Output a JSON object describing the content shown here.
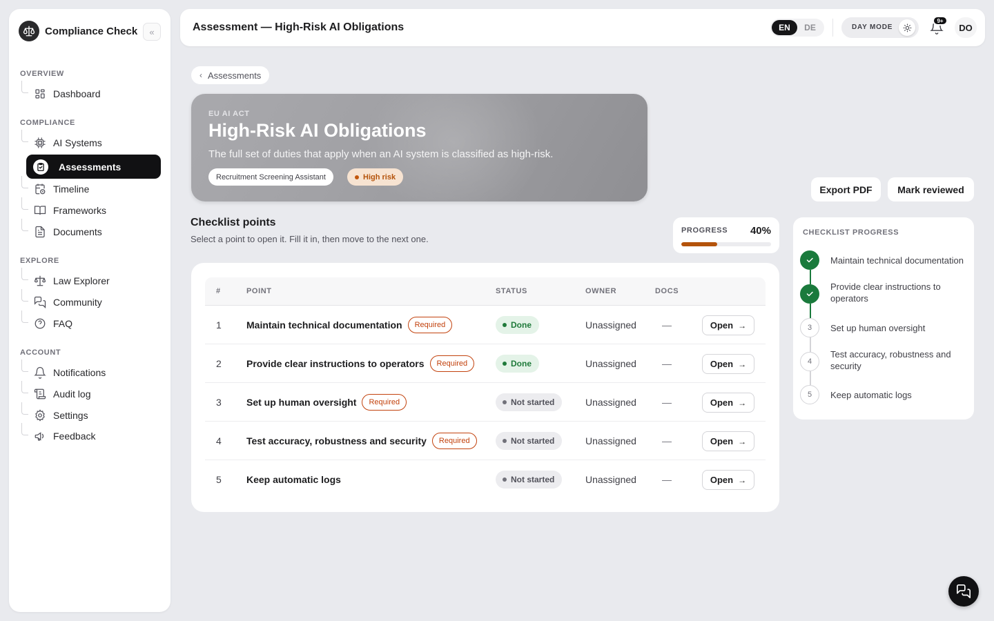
{
  "app": {
    "name": "Compliance Check",
    "collapse_glyph": "«"
  },
  "sidebar": {
    "sections": [
      {
        "label": "OVERVIEW"
      },
      {
        "label": "COMPLIANCE"
      },
      {
        "label": "EXPLORE"
      },
      {
        "label": "ACCOUNT"
      }
    ],
    "items": [
      {
        "label": "Dashboard",
        "icon": "dashboard-icon"
      },
      {
        "label": "AI Systems",
        "icon": "chip-icon"
      },
      {
        "label": "Assessments",
        "icon": "clipboard-check-icon",
        "active": true
      },
      {
        "label": "Timeline",
        "icon": "calendar-clock-icon"
      },
      {
        "label": "Frameworks",
        "icon": "book-open-icon"
      },
      {
        "label": "Documents",
        "icon": "document-icon"
      },
      {
        "label": "Law Explorer",
        "icon": "scale-icon"
      },
      {
        "label": "Community",
        "icon": "chat-bubbles-icon"
      },
      {
        "label": "FAQ",
        "icon": "help-circle-icon"
      },
      {
        "label": "Notifications",
        "icon": "bell-icon"
      },
      {
        "label": "Audit log",
        "icon": "scroll-icon"
      },
      {
        "label": "Settings",
        "icon": "gear-icon"
      },
      {
        "label": "Feedback",
        "icon": "megaphone-icon"
      }
    ]
  },
  "header": {
    "title": "Assessment — High-Risk AI Obligations",
    "lang_en": "EN",
    "lang_de": "DE",
    "mode_label": "DAY MODE",
    "notif_badge": "9+",
    "avatar_initials": "DO"
  },
  "breadcrumb": {
    "label": "Assessments"
  },
  "hero": {
    "kicker": "EU AI ACT",
    "title": "High-Risk AI Obligations",
    "subtitle": "The full set of duties that apply when an AI system is classified as high-risk.",
    "system_chip": "Recruitment Screening Assistant",
    "risk_chip": "High risk"
  },
  "actions": {
    "export": "Export PDF",
    "review": "Mark reviewed"
  },
  "checklist": {
    "title": "Checklist points",
    "subtitle": "Select a point to open it. Fill it in, then move to the next one.",
    "progress_label": "PROGRESS",
    "progress_text": "40%",
    "progress_fraction": 0.4,
    "columns": [
      "#",
      "POINT",
      "STATUS",
      "OWNER",
      "DOCS"
    ],
    "required_label": "Required",
    "open_label": "Open",
    "rows": [
      {
        "num": "1",
        "point": "Maintain technical documentation",
        "required": true,
        "status": "Done",
        "owner": "Unassigned",
        "docs": "—"
      },
      {
        "num": "2",
        "point": "Provide clear instructions to operators",
        "required": true,
        "status": "Done",
        "owner": "Unassigned",
        "docs": "—"
      },
      {
        "num": "3",
        "point": "Set up human oversight",
        "required": true,
        "status": "Not started",
        "owner": "Unassigned",
        "docs": "—"
      },
      {
        "num": "4",
        "point": "Test accuracy, robustness and security",
        "required": true,
        "status": "Not started",
        "owner": "Unassigned",
        "docs": "—"
      },
      {
        "num": "5",
        "point": "Keep automatic logs",
        "required": false,
        "status": "Not started",
        "owner": "Unassigned",
        "docs": "—"
      }
    ]
  },
  "side_progress": {
    "title": "CHECKLIST PROGRESS",
    "steps": [
      {
        "num": "1",
        "label": "Maintain technical documentation",
        "done": true
      },
      {
        "num": "2",
        "label": "Provide clear instructions to operators",
        "done": true
      },
      {
        "num": "3",
        "label": "Set up human oversight",
        "done": false
      },
      {
        "num": "4",
        "label": "Test accuracy, robustness and security",
        "done": false
      },
      {
        "num": "5",
        "label": "Keep automatic logs",
        "done": false
      }
    ]
  },
  "colors": {
    "accent": "#b4530b",
    "done": "#1a7a3c",
    "dark": "#111113"
  }
}
